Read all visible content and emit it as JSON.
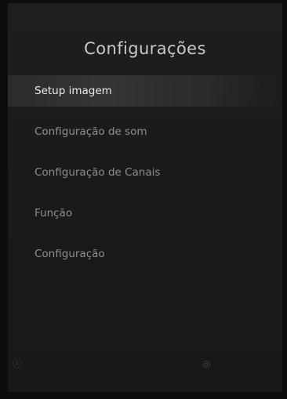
{
  "menu": {
    "title": "Configurações",
    "items": [
      {
        "label": "Setup imagem",
        "selected": true
      },
      {
        "label": "Configuração de som",
        "selected": false
      },
      {
        "label": "Configuração de Canais",
        "selected": false
      },
      {
        "label": "Função",
        "selected": false
      },
      {
        "label": "Configuração",
        "selected": false
      }
    ]
  },
  "footer": {
    "left_icon": "info-icon",
    "left_glyph": "ⓘ",
    "right_icon": "ok-button-icon",
    "right_glyph": "◎"
  },
  "colors": {
    "background": "#1d1c1d",
    "selected_text": "#ebebeb",
    "item_text": "#8f8f8f",
    "title_text": "#c9c9c9"
  }
}
